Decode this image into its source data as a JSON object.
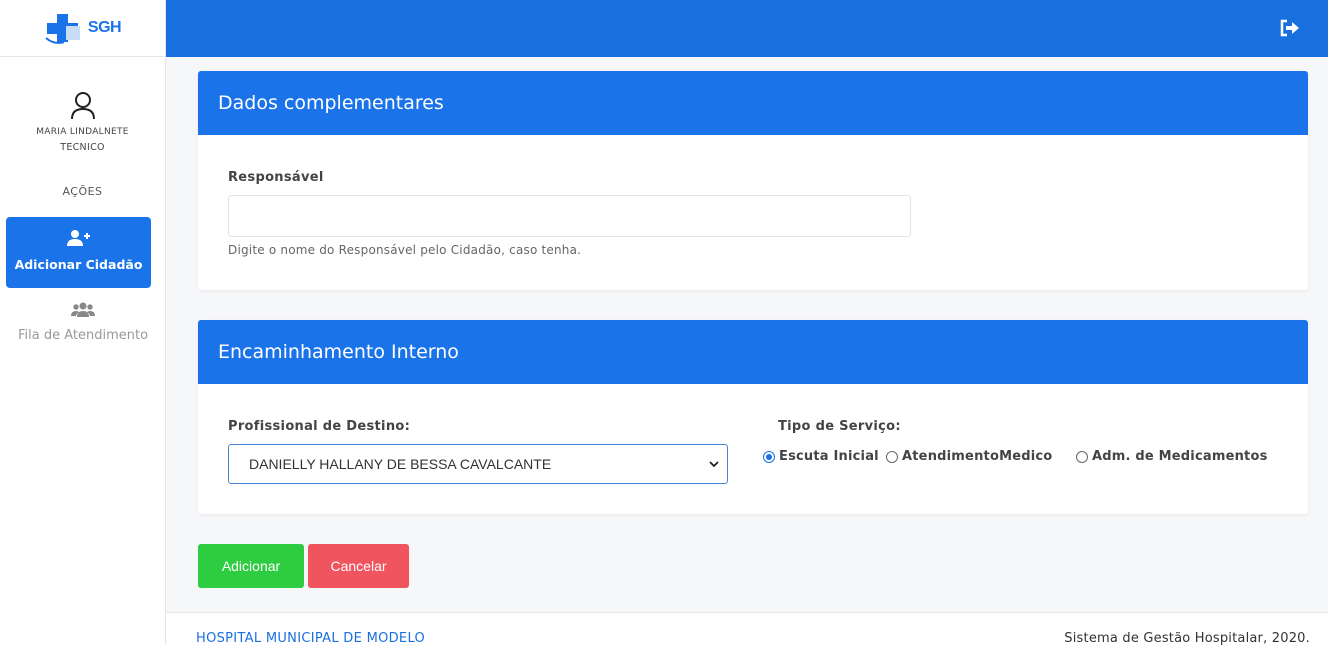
{
  "app": {
    "logo_text": "SGH",
    "brand_color": "#1a73e8"
  },
  "sidebar": {
    "user_name": "MARIA LINDALNETE",
    "user_role": "TECNICO",
    "section_label": "AÇÕES",
    "items": [
      {
        "label": "Adicionar Cidadão",
        "icon": "user-plus-icon",
        "active": true
      },
      {
        "label": "Fila de Atendimento",
        "icon": "users-icon",
        "active": false
      }
    ]
  },
  "topbar": {
    "logout_icon": "sign-out-icon"
  },
  "complementary": {
    "title": "Dados complementares",
    "responsavel_label": "Responsável",
    "responsavel_value": "",
    "responsavel_help": "Digite o nome do Responsável pelo Cidadão, caso tenha."
  },
  "referral": {
    "title": "Encaminhamento Interno",
    "professional_label": "Profissional de Destino:",
    "professional_selected": "DANIELLY HALLANY DE BESSA CAVALCANTE",
    "service_label": "Tipo de Serviço:",
    "service_options": [
      {
        "label": "Escuta Inicial",
        "checked": true
      },
      {
        "label": "AtendimentoMedico",
        "checked": false
      },
      {
        "label": "Adm. de Medicamentos",
        "checked": false
      }
    ]
  },
  "actions": {
    "add_label": "Adicionar",
    "cancel_label": "Cancelar",
    "add_color": "#2ecc40",
    "cancel_color": "#f0545f"
  },
  "footer": {
    "left": "HOSPITAL MUNICIPAL DE MODELO",
    "right": "Sistema de Gestão Hospitalar, 2020."
  }
}
